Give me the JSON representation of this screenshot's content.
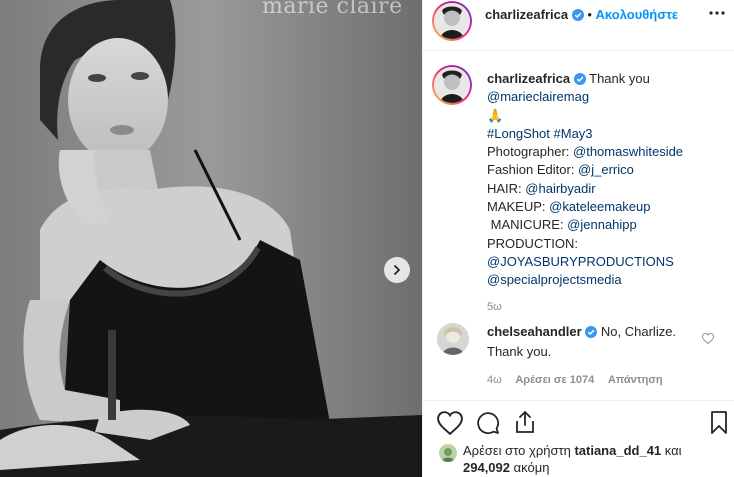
{
  "post": {
    "photo_watermark": "marie claire",
    "author": "charlizeafrica",
    "follow_label": "Ακολουθήστε",
    "separator": "•",
    "more_icon": "more-horizontal-icon",
    "caption": {
      "username": "charlizeafrica",
      "text": "Thank you",
      "mention1": "@marieclairemag",
      "emoji": "🙏",
      "hashtags": "#LongShot #May3",
      "photographer_label": "Photographer: ",
      "photographer": "@thomaswhiteside",
      "fashion_label": "Fashion Editor: ",
      "fashion": "@j_errico",
      "hair_label": "HAIR: ",
      "hair": "@hairbyadir",
      "makeup_label": "MAKEUP: ",
      "makeup": "@kateleemakeup",
      "manicure_label": " MANICURE: ",
      "manicure": "@jennahipp",
      "production_label": "PRODUCTION:",
      "production1": "@JOYASBURYPRODUCTIONS",
      "production2": "@specialprojectsmedia",
      "time": "5ω"
    },
    "comment": {
      "username": "chelseahandler",
      "text1": "No, Charlize.",
      "text2": "Thank you.",
      "time": "4ω",
      "likes": "Αρέσει σε 1074",
      "reply": "Απάντηση"
    },
    "likes_line1_prefix": "Αρέσει στο χρήστη ",
    "likes_user": "tatiana_dd_41",
    "likes_line1_suffix": " και",
    "likes_count": "294,092",
    "likes_line2_suffix": " ακόμη"
  },
  "colors": {
    "link": "#00376b",
    "accent": "#0095f6",
    "verified": "#3897f0"
  }
}
